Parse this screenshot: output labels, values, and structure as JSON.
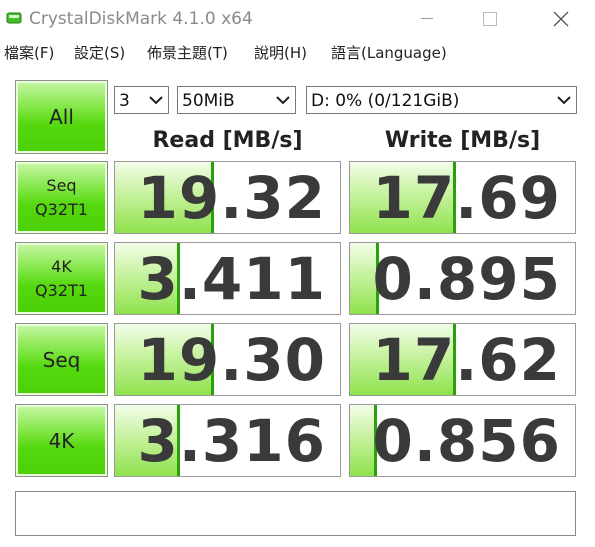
{
  "window": {
    "title": "CrystalDiskMark 4.1.0 x64"
  },
  "menu": [
    "檔案(F)",
    "設定(S)",
    "佈景主題(T)",
    "說明(H)",
    "語言(Language)"
  ],
  "controls": {
    "all_label": "All",
    "count": "3",
    "size": "50MiB",
    "drive": "D: 0% (0/121GiB)"
  },
  "headers": {
    "read": "Read [MB/s]",
    "write": "Write [MB/s]"
  },
  "tests": [
    {
      "label_line1": "Seq",
      "label_line2": "Q32T1",
      "read": "19.32",
      "write": "17.69",
      "read_fill": 0.44,
      "write_fill": 0.47
    },
    {
      "label_line1": "4K",
      "label_line2": "Q32T1",
      "read": "3.411",
      "write": "0.895",
      "read_fill": 0.29,
      "write_fill": 0.13
    },
    {
      "label_line1": "Seq",
      "label_line2": "",
      "read": "19.30",
      "write": "17.62",
      "read_fill": 0.44,
      "write_fill": 0.47
    },
    {
      "label_line1": "4K",
      "label_line2": "",
      "read": "3.316",
      "write": "0.856",
      "read_fill": 0.29,
      "write_fill": 0.12
    }
  ],
  "comment": "",
  "colors": {
    "accent_green": "#56d80f",
    "value_text": "#3a3a3a"
  }
}
